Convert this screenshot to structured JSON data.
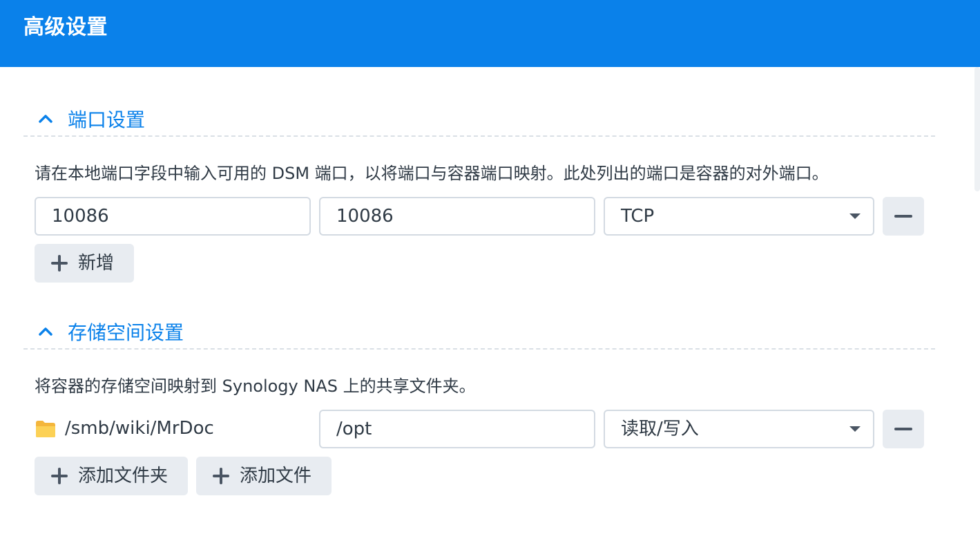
{
  "header": {
    "title": "高级设置"
  },
  "ports": {
    "title": "端口设置",
    "description": "请在本地端口字段中输入可用的 DSM 端口，以将端口与容器端口映射。此处列出的端口是容器的对外端口。",
    "rows": [
      {
        "local_port": "10086",
        "container_port": "10086",
        "protocol": "TCP"
      }
    ],
    "add_label": "新增"
  },
  "storage": {
    "title": "存储空间设置",
    "description": "将容器的存储空间映射到 Synology NAS 上的共享文件夹。",
    "rows": [
      {
        "path": "/smb/wiki/MrDoc",
        "mount_path": "/opt",
        "permission": "读取/写入"
      }
    ],
    "add_folder_label": "添加文件夹",
    "add_file_label": "添加文件"
  },
  "colors": {
    "accent": "#0a81ea",
    "button_bg": "#e8ecf1",
    "folder": "#f7c948"
  },
  "icons": {
    "collapse": "chevron-up-icon",
    "add": "plus-icon",
    "remove": "minus-icon",
    "dropdown": "caret-down-icon",
    "folder": "folder-icon"
  }
}
